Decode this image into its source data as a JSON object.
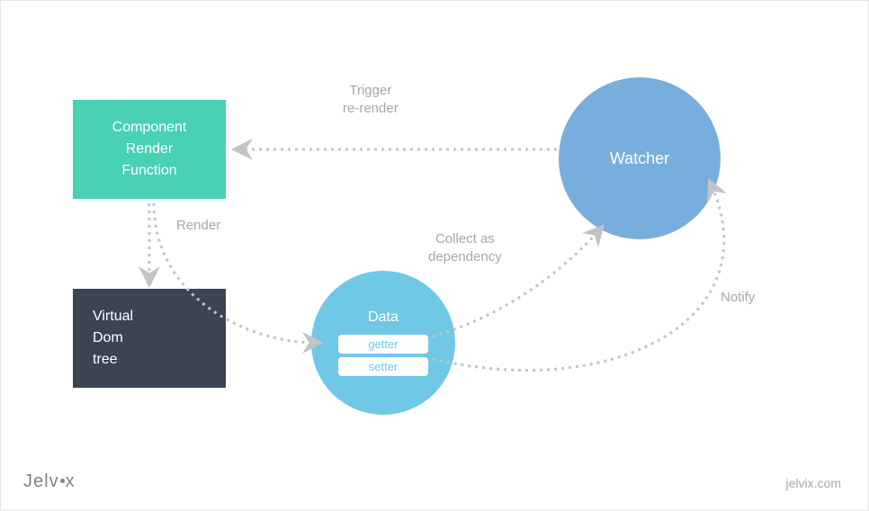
{
  "nodes": {
    "component_render": {
      "line1": "Component",
      "line2": "Render",
      "line3": "Function"
    },
    "virtual_dom": {
      "line1": "Virtual",
      "line2": "Dom",
      "line3": "tree"
    },
    "data": {
      "label": "Data",
      "getter": "getter",
      "setter": "setter"
    },
    "watcher": {
      "label": "Watcher"
    }
  },
  "edges": {
    "trigger": {
      "line1": "Trigger",
      "line2": "re-render"
    },
    "render": {
      "label": "Render"
    },
    "collect": {
      "line1": "Collect as",
      "line2": "dependency"
    },
    "notify": {
      "label": "Notify"
    }
  },
  "brand": {
    "pre": "Jelv",
    "post": "x"
  },
  "url": "jelvix.com",
  "colors": {
    "teal": "#48d1b3",
    "slate": "#3c4451",
    "skyblue": "#6fc9e6",
    "blue": "#78aedb",
    "gray_text": "#a5a7ab"
  }
}
